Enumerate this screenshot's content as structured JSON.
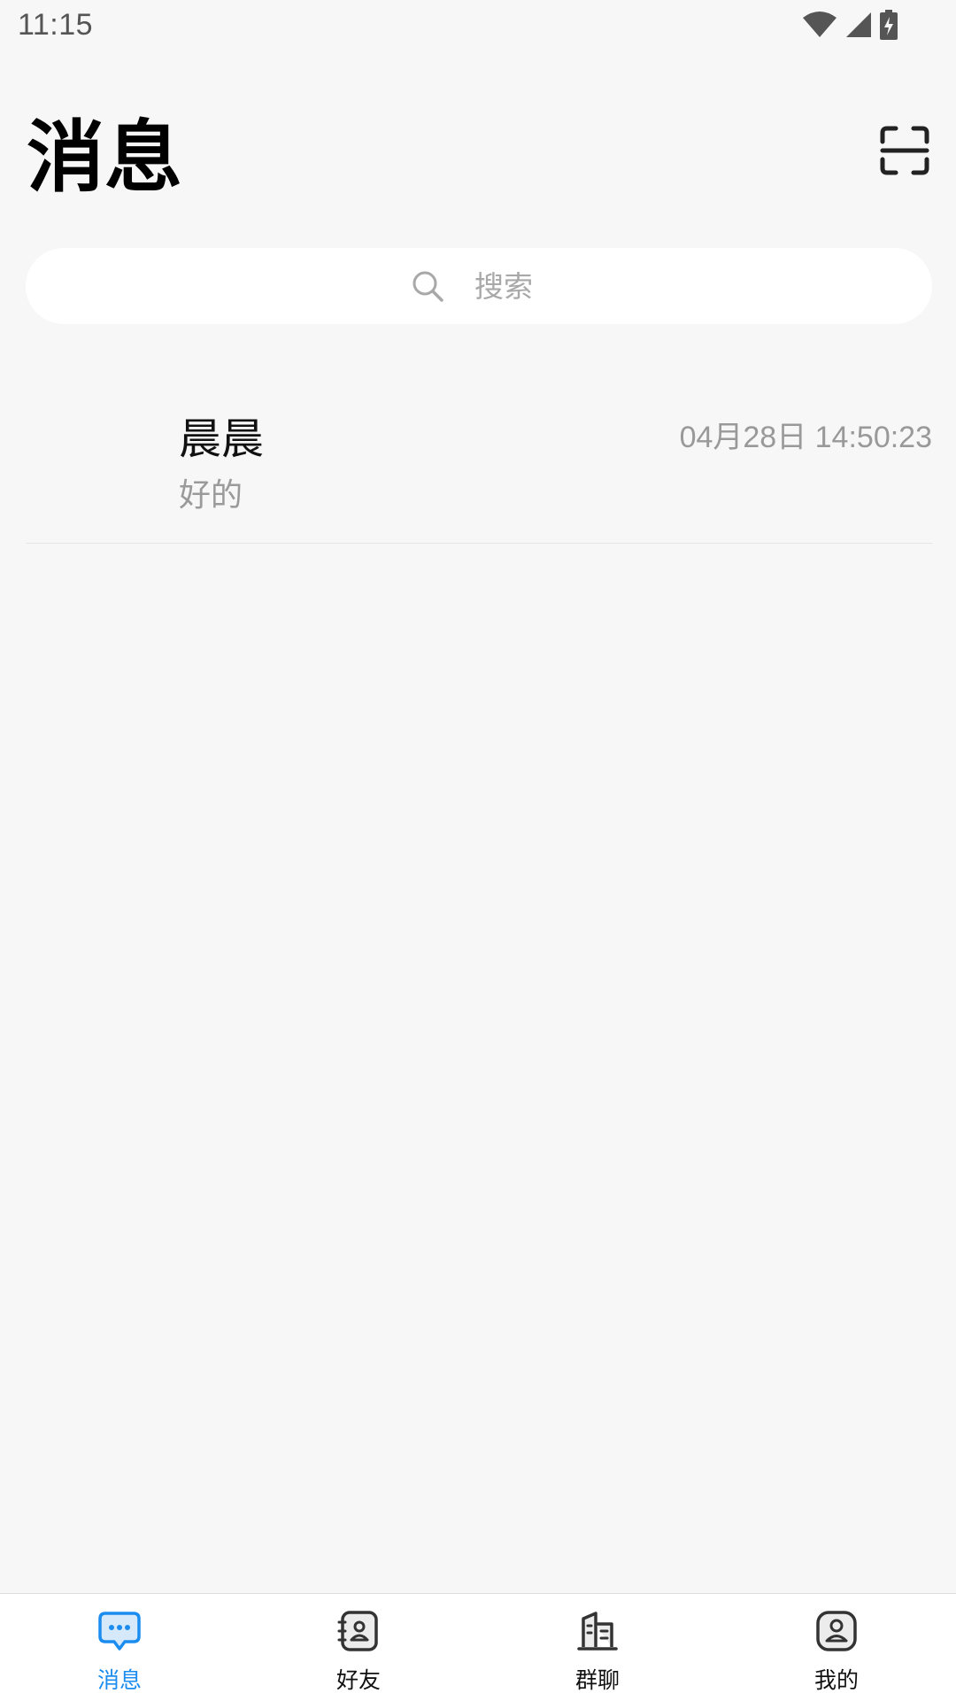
{
  "status_bar": {
    "time": "11:15"
  },
  "header": {
    "title": "消息"
  },
  "search": {
    "placeholder": "搜索"
  },
  "conversations": [
    {
      "name": "晨晨",
      "preview": "好的",
      "time": "04月28日 14:50:23"
    }
  ],
  "tab_bar": {
    "items": [
      {
        "label": "消息",
        "icon": "chat-bubble-icon",
        "active": true
      },
      {
        "label": "好友",
        "icon": "contacts-icon",
        "active": false
      },
      {
        "label": "群聊",
        "icon": "buildings-icon",
        "active": false
      },
      {
        "label": "我的",
        "icon": "profile-icon",
        "active": false
      }
    ]
  },
  "colors": {
    "background": "#f7f7f7",
    "accent": "#1c8df0",
    "secondary_text": "#999999"
  }
}
